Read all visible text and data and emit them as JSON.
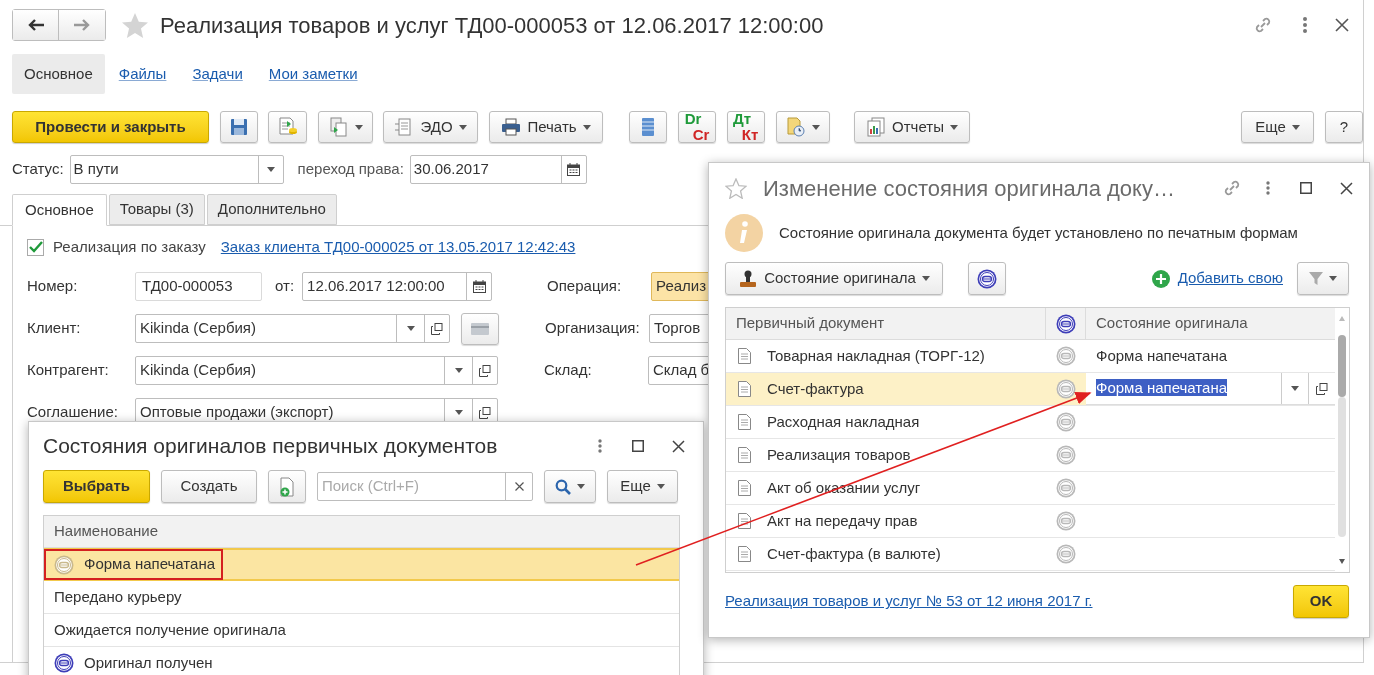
{
  "window": {
    "title": "Реализация товаров и услуг ТД00-000053 от 12.06.2017 12:00:00",
    "nav": [
      {
        "label": "Основное",
        "selected": true
      },
      {
        "label": "Файлы",
        "selected": false
      },
      {
        "label": "Задачи",
        "selected": false
      },
      {
        "label": "Мои заметки",
        "selected": false
      }
    ]
  },
  "toolbar": {
    "post": "Провести и закрыть",
    "edo": "ЭДО",
    "print": "Печать",
    "dr_cr": [
      "Dr",
      "Cr"
    ],
    "dt_kt": [
      "Дт",
      "Кт"
    ],
    "reports": "Отчеты",
    "more": "Еще",
    "help": "?"
  },
  "status": {
    "label": "Статус:",
    "value": "В пути",
    "transfer_label": "переход права:",
    "transfer_date": "30.06.2017"
  },
  "tabs": [
    {
      "label": "Основное",
      "selected": true
    },
    {
      "label": "Товары (3)",
      "selected": false
    },
    {
      "label": "Дополнительно",
      "selected": false
    }
  ],
  "by_order": {
    "label": "Реализация по заказу",
    "checked": true,
    "link": "Заказ клиента ТД00-000025 от 13.05.2017 12:42:43"
  },
  "number": {
    "label": "Номер:",
    "value": "ТД00-000053",
    "date_label": "от:",
    "date": "12.06.2017 12:00:00"
  },
  "fields": [
    {
      "label": "Клиент:",
      "value": "Kikinda (Сербия)",
      "card": true
    },
    {
      "label": "Контрагент:",
      "value": "Kikinda (Сербия)",
      "card": false
    },
    {
      "label": "Соглашение:",
      "value": "Оптовые продажи (экспорт)",
      "card": false
    }
  ],
  "right_fields": [
    {
      "label": "Операция:",
      "value": "Реализ",
      "highlighted": true
    },
    {
      "label": "Организация:",
      "value": "Торгов",
      "highlighted": false
    },
    {
      "label": "Склад:",
      "value": "Склад б",
      "highlighted": false
    }
  ],
  "states_dialog": {
    "title": "Состояния оригиналов первичных документов",
    "select": "Выбрать",
    "create": "Создать",
    "search_placeholder": "Поиск (Ctrl+F)",
    "more": "Еще",
    "column": "Наименование",
    "rows": [
      {
        "name": "Форма напечатана",
        "selected": true,
        "annotated": true,
        "color": "#c9b98c"
      },
      {
        "name": "Передано курьеру",
        "selected": false,
        "annotated": false
      },
      {
        "name": "Ожидается получение оригинала",
        "selected": false,
        "annotated": false
      },
      {
        "name": "Оригинал получен",
        "selected": false,
        "annotated": false,
        "color": "#3d3db8"
      }
    ]
  },
  "change_dialog": {
    "title": "Изменение состояния оригинала доку…",
    "info": "Состояние оригинала документа будет установлено по печатным формам",
    "state_button": "Состояние оригинала",
    "add_link": "Добавить свою",
    "columns": [
      "Первичный документ",
      "Состояние оригинала"
    ],
    "rows": [
      {
        "document": "Товарная накладная (ТОРГ-12)",
        "state": "Форма напечатана",
        "selected": false
      },
      {
        "document": "Счет-фактура",
        "state": "Форма напечатана",
        "selected": true
      },
      {
        "document": "Расходная накладная",
        "selected": false
      },
      {
        "document": "Реализация товаров",
        "selected": false
      },
      {
        "document": "Акт об оказании услуг",
        "selected": false
      },
      {
        "document": "Акт на передачу прав",
        "selected": false
      },
      {
        "document": "Счет-фактура (в валюте)",
        "selected": false
      }
    ],
    "footer_link": "Реализация товаров и услуг № 53 от 12 июня 2017 г.",
    "ok": "OK"
  }
}
